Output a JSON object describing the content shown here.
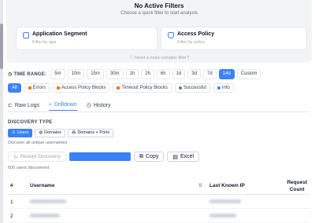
{
  "filters": {
    "empty_title": "No Active Filters",
    "empty_subtitle": "Choose a quick filter to start analysis",
    "quick_filters": [
      {
        "title": "Application Segment",
        "subtitle": "Filter by app"
      },
      {
        "title": "Access Policy",
        "subtitle": "Filter by policy"
      }
    ],
    "complex_link": "Need a more complex filter?"
  },
  "time_range": {
    "label": "TIME RANGE:",
    "options": [
      "5m",
      "10m",
      "15m",
      "30m",
      "1h",
      "2h",
      "6h",
      "1d",
      "3d",
      "7d",
      "14d",
      "Custom"
    ],
    "selected": "14d"
  },
  "categories": {
    "all_label": "All",
    "items": [
      {
        "label": "Errors",
        "color": "#f97316"
      },
      {
        "label": "Access Policy Blocks",
        "color": "#f97316"
      },
      {
        "label": "Timeout Policy Blocks",
        "color": "#f97316"
      },
      {
        "label": "Successful",
        "color": "#6b7280"
      },
      {
        "label": "Info",
        "color": "#3b82f6"
      }
    ]
  },
  "tabs": [
    {
      "label": "Raw Logs",
      "icon": "code-icon"
    },
    {
      "label": "Drilldown",
      "icon": "search-icon"
    },
    {
      "label": "History",
      "icon": "clock-icon"
    }
  ],
  "active_tab": "Drilldown",
  "discovery": {
    "title": "DISCOVERY TYPE",
    "types": [
      {
        "label": "Users",
        "icon": "user-icon"
      },
      {
        "label": "Domains",
        "icon": "globe-icon"
      },
      {
        "label": "Domains + Ports",
        "icon": "network-icon"
      }
    ],
    "selected": "Users",
    "hint": "Discover all unique usernames",
    "restart_label": "Restart Discovery",
    "progress": 1.0,
    "copy_label": "Copy",
    "excel_label": "Excel",
    "count_text": "600 users discovered"
  },
  "table": {
    "col_num": "#",
    "col_username": "Username",
    "col_ip": "Last Known IP",
    "col_requests_line1": "Request",
    "col_requests_line2": "Count",
    "rows": [
      {
        "num": "1"
      },
      {
        "num": "2"
      }
    ]
  },
  "colors": {
    "accent": "#3b82f6",
    "warning": "#f97316"
  }
}
